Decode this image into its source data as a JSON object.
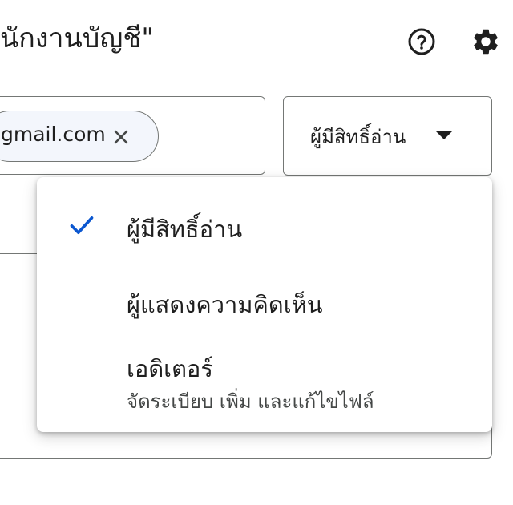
{
  "header": {
    "title": "นักงานบัญชี\"",
    "help_icon": "help-circle-icon",
    "settings_icon": "gear-icon"
  },
  "share": {
    "chip_email": "gmail.com",
    "role_selected": "ผู้มีสิทธิ์อ่าน"
  },
  "menu": {
    "items": [
      {
        "label": "ผู้มีสิทธิ์อ่าน",
        "selected": true
      },
      {
        "label": "ผู้แสดงความคิดเห็น",
        "selected": false
      },
      {
        "label": "เอดิเตอร์",
        "description": "จัดระเบียบ เพิ่ม และแก้ไขไฟล์",
        "selected": false
      }
    ]
  },
  "colors": {
    "accent": "#0b57d0",
    "border": "#747775",
    "text": "#1f1f1f"
  }
}
